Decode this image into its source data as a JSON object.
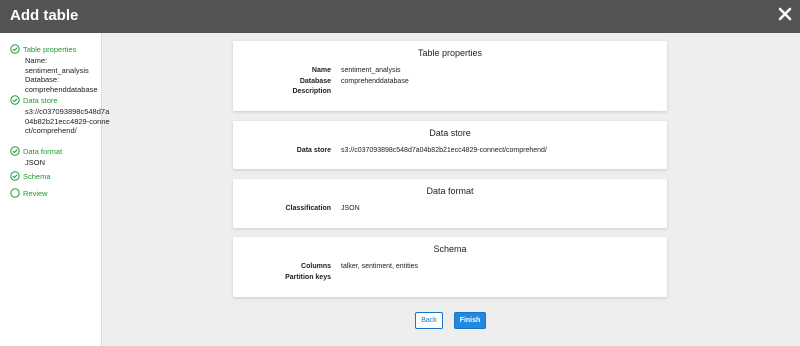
{
  "header": {
    "title": "Add table",
    "close_icon": "close-icon"
  },
  "sidebar": {
    "steps": [
      {
        "label": "Table properties",
        "status": "completed",
        "details": [
          "Name:",
          "sentiment_analysis",
          "Database:",
          "comprehenddatabase"
        ]
      },
      {
        "label": "Data store",
        "status": "completed",
        "details": [
          "s3://c037093898c548d7a04b82b21ecc4829-connect/comprehend/"
        ]
      },
      {
        "label": "Data format",
        "status": "completed",
        "details": [
          "JSON"
        ]
      },
      {
        "label": "Schema",
        "status": "completed",
        "details": []
      },
      {
        "label": "Review",
        "status": "pending",
        "details": []
      }
    ]
  },
  "main": {
    "cards": [
      {
        "title": "Table properties",
        "rows": [
          {
            "label": "Name",
            "value": "sentiment_analysis"
          },
          {
            "label": "Database",
            "value": "comprehenddatabase"
          },
          {
            "label": "Description",
            "value": ""
          }
        ]
      },
      {
        "title": "Data store",
        "rows": [
          {
            "label": "Data store",
            "value": "s3://c037093898c548d7a04b82b21ecc4829-connect/comprehend/"
          }
        ]
      },
      {
        "title": "Data format",
        "rows": [
          {
            "label": "Classification",
            "value": "JSON"
          }
        ]
      },
      {
        "title": "Schema",
        "rows": [
          {
            "label": "Columns",
            "value": "talker, sentiment, entities"
          },
          {
            "label": "Partition keys",
            "value": ""
          }
        ]
      }
    ]
  },
  "footer": {
    "back_label": "Back",
    "finish_label": "Finish"
  },
  "colors": {
    "header_bg": "#545454",
    "step_green": "#1f9b2f",
    "primary_blue": "#1f8ae0"
  }
}
